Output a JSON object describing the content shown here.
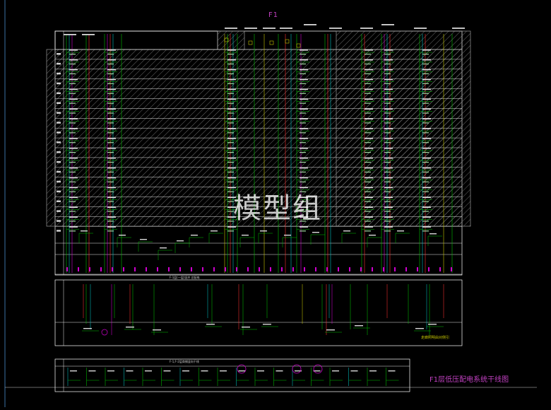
{
  "drawing": {
    "title": "F1",
    "watermark": "模型组",
    "caption": "F1层低压配电系统干线图",
    "note": "走廊照明由对侧引",
    "lower_section_label": "F-1层(一层)竖井 总配电",
    "bottom_section_label": "F-1,F-2层商铺竖向干线"
  },
  "colors": {
    "background": "#000000",
    "frame": "#ffffff",
    "feeder_green": "#00c000",
    "feeder_red": "#ff3030",
    "feeder_cyan": "#00c0c0",
    "feeder_magenta": "#d000d0",
    "feeder_yellow": "#c8c800",
    "title_magenta": "#c040c0"
  }
}
